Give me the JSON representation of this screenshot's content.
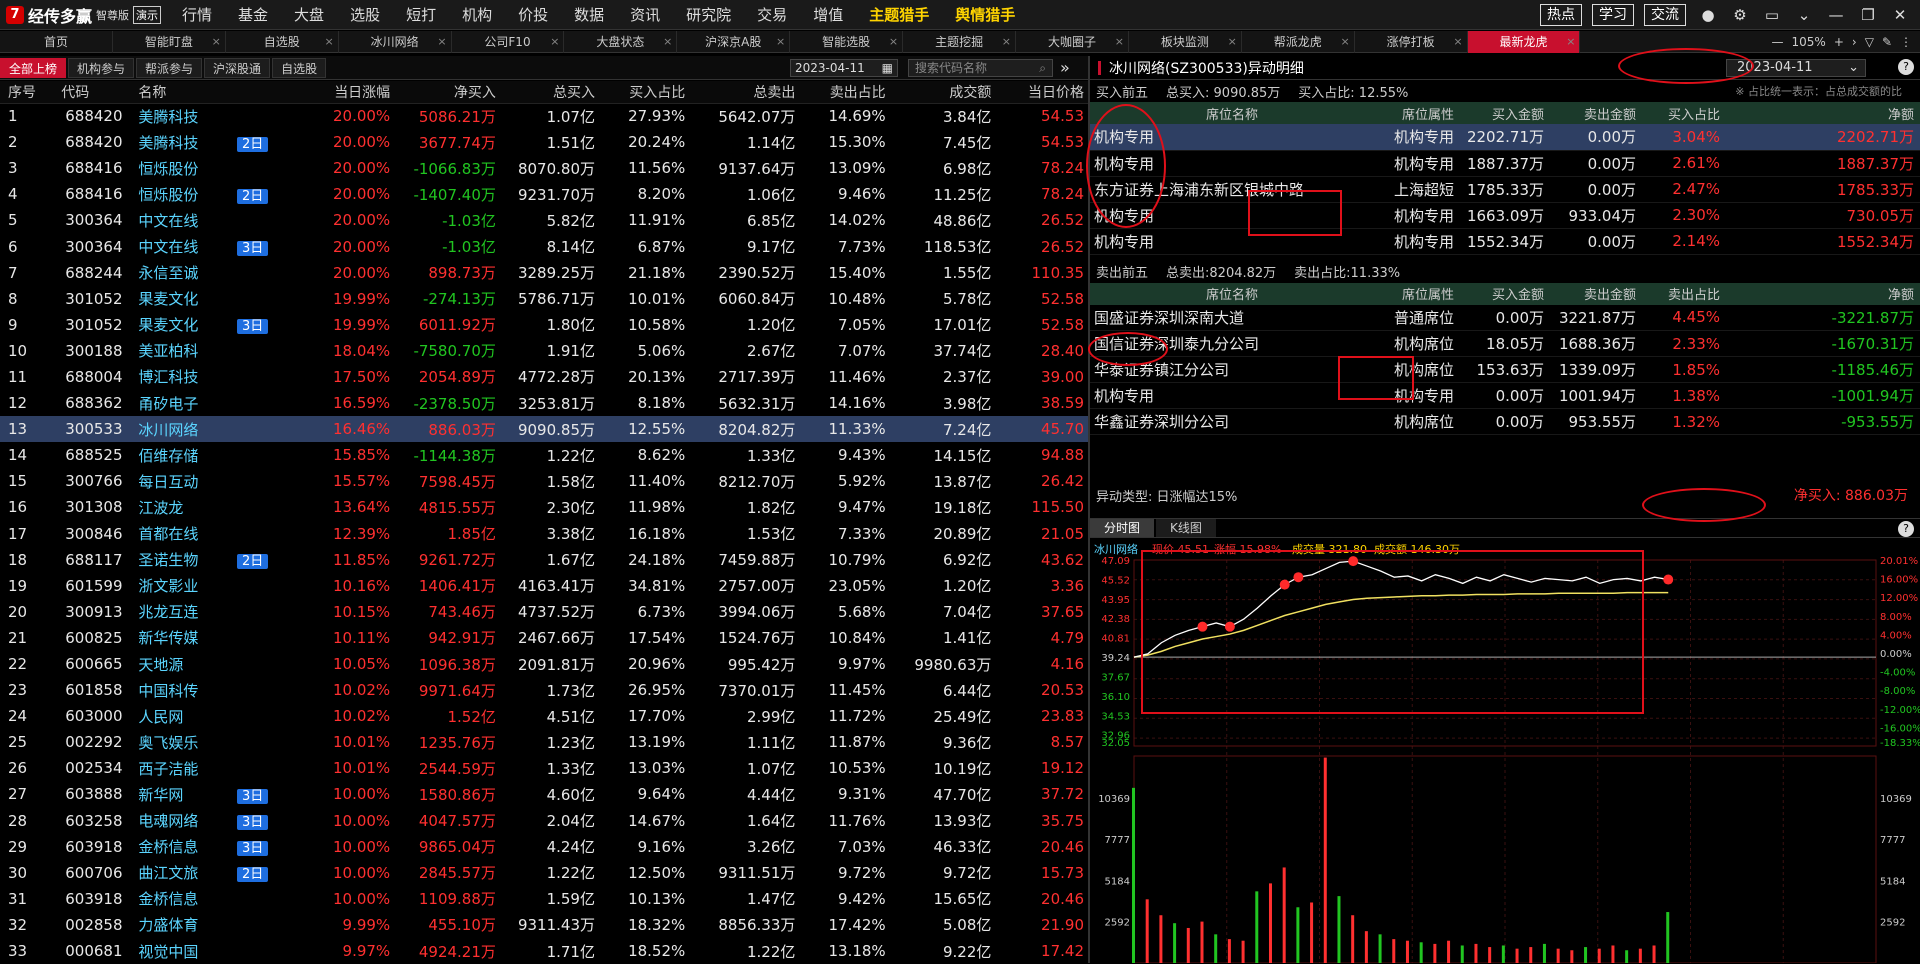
{
  "app": {
    "logo_text": "经传多赢",
    "logo_sub": "智尊版",
    "demo_badge": "演示"
  },
  "top_menu": [
    {
      "label": "行情",
      "hl": false,
      "dot": false
    },
    {
      "label": "基金",
      "hl": false,
      "dot": false
    },
    {
      "label": "大盘",
      "hl": false,
      "dot": false
    },
    {
      "label": "选股",
      "hl": false,
      "dot": false
    },
    {
      "label": "短打",
      "hl": false,
      "dot": false
    },
    {
      "label": "机构",
      "hl": false,
      "dot": false
    },
    {
      "label": "价投",
      "hl": false,
      "dot": false
    },
    {
      "label": "数据",
      "hl": false,
      "dot": false
    },
    {
      "label": "资讯",
      "hl": false,
      "dot": false
    },
    {
      "label": "研究院",
      "hl": false,
      "dot": false
    },
    {
      "label": "交易",
      "hl": false,
      "dot": false
    },
    {
      "label": "增值",
      "hl": false,
      "dot": true
    },
    {
      "label": "主题猎手",
      "hl": true,
      "dot": true
    },
    {
      "label": "舆情猎手",
      "hl": true,
      "dot": true
    }
  ],
  "top_right": {
    "btn_hot": "热点",
    "btn_learn": "学习",
    "btn_talk": "交流",
    "zoom": "105%"
  },
  "tabs": [
    "首页",
    "智能盯盘",
    "自选股",
    "冰川网络",
    "公司F10",
    "大盘状态",
    "沪深京A股",
    "智能选股",
    "主题挖掘",
    "大咖圈子",
    "板块监测",
    "帮派龙虎",
    "涨停打板",
    "最新龙虎"
  ],
  "active_tab": 13,
  "left": {
    "subtabs": [
      "全部上榜",
      "机构参与",
      "帮派参与",
      "沪深股通",
      "自选股"
    ],
    "date": "2023-04-11",
    "search_placeholder": "搜索代码名称",
    "columns": [
      "序号",
      "代码",
      "名称",
      "",
      "当日涨幅",
      "净买入",
      "总买入",
      "买入占比",
      "总卖出",
      "卖出占比",
      "成交额",
      "当日价格"
    ],
    "rows": [
      [
        "1",
        "688420",
        "美腾科技",
        "",
        "20.00%",
        "5086.21万",
        "1.07亿",
        "27.93%",
        "5642.07万",
        "14.69%",
        "3.84亿",
        "54.53"
      ],
      [
        "2",
        "688420",
        "美腾科技",
        "2日",
        "20.00%",
        "3677.74万",
        "1.51亿",
        "20.24%",
        "1.14亿",
        "15.30%",
        "7.45亿",
        "54.53"
      ],
      [
        "3",
        "688416",
        "恒烁股份",
        "",
        "20.00%",
        "-1066.83万",
        "8070.80万",
        "11.56%",
        "9137.64万",
        "13.09%",
        "6.98亿",
        "78.24"
      ],
      [
        "4",
        "688416",
        "恒烁股份",
        "2日",
        "20.00%",
        "-1407.40万",
        "9231.70万",
        "8.20%",
        "1.06亿",
        "9.46%",
        "11.25亿",
        "78.24"
      ],
      [
        "5",
        "300364",
        "中文在线",
        "",
        "20.00%",
        "-1.03亿",
        "5.82亿",
        "11.91%",
        "6.85亿",
        "14.02%",
        "48.86亿",
        "26.52"
      ],
      [
        "6",
        "300364",
        "中文在线",
        "3日",
        "20.00%",
        "-1.03亿",
        "8.14亿",
        "6.87%",
        "9.17亿",
        "7.73%",
        "118.53亿",
        "26.52"
      ],
      [
        "7",
        "688244",
        "永信至诚",
        "",
        "20.00%",
        "898.73万",
        "3289.25万",
        "21.18%",
        "2390.52万",
        "15.40%",
        "1.55亿",
        "110.35"
      ],
      [
        "8",
        "301052",
        "果麦文化",
        "",
        "19.99%",
        "-274.13万",
        "5786.71万",
        "10.01%",
        "6060.84万",
        "10.48%",
        "5.78亿",
        "52.58"
      ],
      [
        "9",
        "301052",
        "果麦文化",
        "3日",
        "19.99%",
        "6011.92万",
        "1.80亿",
        "10.58%",
        "1.20亿",
        "7.05%",
        "17.01亿",
        "52.58"
      ],
      [
        "10",
        "300188",
        "美亚柏科",
        "",
        "18.04%",
        "-7580.70万",
        "1.91亿",
        "5.06%",
        "2.67亿",
        "7.07%",
        "37.74亿",
        "28.40"
      ],
      [
        "11",
        "688004",
        "博汇科技",
        "",
        "17.50%",
        "2054.89万",
        "4772.28万",
        "20.13%",
        "2717.39万",
        "11.46%",
        "2.37亿",
        "39.00"
      ],
      [
        "12",
        "688362",
        "甬矽电子",
        "",
        "16.59%",
        "-2378.50万",
        "3253.81万",
        "8.18%",
        "5632.31万",
        "14.16%",
        "3.98亿",
        "38.59"
      ],
      [
        "13",
        "300533",
        "冰川网络",
        "",
        "16.46%",
        "886.03万",
        "9090.85万",
        "12.55%",
        "8204.82万",
        "11.33%",
        "7.24亿",
        "45.70"
      ],
      [
        "14",
        "688525",
        "佰维存储",
        "",
        "15.85%",
        "-1144.38万",
        "1.22亿",
        "8.62%",
        "1.33亿",
        "9.43%",
        "14.15亿",
        "94.88"
      ],
      [
        "15",
        "300766",
        "每日互动",
        "",
        "15.57%",
        "7598.45万",
        "1.58亿",
        "11.40%",
        "8212.70万",
        "5.92%",
        "13.87亿",
        "26.42"
      ],
      [
        "16",
        "301308",
        "江波龙",
        "",
        "13.64%",
        "4815.55万",
        "2.30亿",
        "11.98%",
        "1.82亿",
        "9.47%",
        "19.18亿",
        "115.50"
      ],
      [
        "17",
        "300846",
        "首都在线",
        "",
        "12.39%",
        "1.85亿",
        "3.38亿",
        "16.18%",
        "1.53亿",
        "7.33%",
        "20.89亿",
        "21.05"
      ],
      [
        "18",
        "688117",
        "圣诺生物",
        "2日",
        "11.85%",
        "9261.72万",
        "1.67亿",
        "24.18%",
        "7459.88万",
        "10.79%",
        "6.92亿",
        "43.62"
      ],
      [
        "19",
        "601599",
        "浙文影业",
        "",
        "10.16%",
        "1406.41万",
        "4163.41万",
        "34.81%",
        "2757.00万",
        "23.05%",
        "1.20亿",
        "3.36"
      ],
      [
        "20",
        "300913",
        "兆龙互连",
        "",
        "10.15%",
        "743.46万",
        "4737.52万",
        "6.73%",
        "3994.06万",
        "5.68%",
        "7.04亿",
        "37.65"
      ],
      [
        "21",
        "600825",
        "新华传媒",
        "",
        "10.11%",
        "942.91万",
        "2467.66万",
        "17.54%",
        "1524.76万",
        "10.84%",
        "1.41亿",
        "4.79"
      ],
      [
        "22",
        "600665",
        "天地源",
        "",
        "10.05%",
        "1096.38万",
        "2091.81万",
        "20.96%",
        "995.42万",
        "9.97%",
        "9980.63万",
        "4.16"
      ],
      [
        "23",
        "601858",
        "中国科传",
        "",
        "10.02%",
        "9971.64万",
        "1.73亿",
        "26.95%",
        "7370.01万",
        "11.45%",
        "6.44亿",
        "20.53"
      ],
      [
        "24",
        "603000",
        "人民网",
        "",
        "10.02%",
        "1.52亿",
        "4.51亿",
        "17.70%",
        "2.99亿",
        "11.72%",
        "25.49亿",
        "23.83"
      ],
      [
        "25",
        "002292",
        "奥飞娱乐",
        "",
        "10.01%",
        "1235.76万",
        "1.23亿",
        "13.19%",
        "1.11亿",
        "11.87%",
        "9.36亿",
        "8.57"
      ],
      [
        "26",
        "002534",
        "西子洁能",
        "",
        "10.01%",
        "2544.59万",
        "1.33亿",
        "13.03%",
        "1.07亿",
        "10.53%",
        "10.19亿",
        "19.12"
      ],
      [
        "27",
        "603888",
        "新华网",
        "3日",
        "10.00%",
        "1580.86万",
        "4.60亿",
        "9.64%",
        "4.44亿",
        "9.31%",
        "47.70亿",
        "37.72"
      ],
      [
        "28",
        "603258",
        "电魂网络",
        "3日",
        "10.00%",
        "4047.57万",
        "2.04亿",
        "14.67%",
        "1.64亿",
        "11.76%",
        "13.93亿",
        "35.75"
      ],
      [
        "29",
        "603918",
        "金桥信息",
        "3日",
        "10.00%",
        "9865.04万",
        "4.24亿",
        "9.16%",
        "3.26亿",
        "7.03%",
        "46.33亿",
        "20.46"
      ],
      [
        "30",
        "600706",
        "曲江文旅",
        "2日",
        "10.00%",
        "2845.57万",
        "1.22亿",
        "12.50%",
        "9311.51万",
        "9.72%",
        "9.72亿",
        "15.73"
      ],
      [
        "31",
        "603918",
        "金桥信息",
        "",
        "10.00%",
        "1109.88万",
        "1.59亿",
        "10.13%",
        "1.47亿",
        "9.42%",
        "15.65亿",
        "20.46"
      ],
      [
        "32",
        "002858",
        "力盛体育",
        "",
        "9.99%",
        "455.10万",
        "9311.43万",
        "18.32%",
        "8856.33万",
        "17.42%",
        "5.08亿",
        "21.90"
      ],
      [
        "33",
        "000681",
        "视觉中国",
        "",
        "9.97%",
        "4924.21万",
        "1.71亿",
        "18.52%",
        "1.22亿",
        "13.18%",
        "9.22亿",
        "17.42"
      ]
    ],
    "selected_row": 12
  },
  "right": {
    "title": "冰川网络(SZ300533)异动明细",
    "date": "2023-04-11",
    "buy_label": "买入前五",
    "buy_total": "总买入: 9090.85万",
    "buy_ratio": "买入占比: 12.55%",
    "note": "※ 占比统一表示：占总成交额的比",
    "seat_columns": [
      "席位名称",
      "席位属性",
      "买入金额",
      "卖出金额",
      "买入占比",
      "净额"
    ],
    "buy_rows": [
      [
        "机构专用",
        "机构专用",
        "2202.71万",
        "0.00万",
        "3.04%",
        "2202.71万"
      ],
      [
        "机构专用",
        "机构专用",
        "1887.37万",
        "0.00万",
        "2.61%",
        "1887.37万"
      ],
      [
        "东方证券上海浦东新区银城中路",
        "上海超短",
        "1785.33万",
        "0.00万",
        "2.47%",
        "1785.33万"
      ],
      [
        "机构专用",
        "机构专用",
        "1663.09万",
        "933.04万",
        "2.30%",
        "730.05万"
      ],
      [
        "机构专用",
        "机构专用",
        "1552.34万",
        "0.00万",
        "2.14%",
        "1552.34万"
      ]
    ],
    "sell_label": "卖出前五",
    "sell_total": "总卖出:8204.82万",
    "sell_ratio": "卖出占比:11.33%",
    "sell_columns": [
      "席位名称",
      "席位属性",
      "买入金额",
      "卖出金额",
      "卖出占比",
      "净额"
    ],
    "sell_rows": [
      [
        "国盛证券深圳深南大道",
        "普通席位",
        "0.00万",
        "3221.87万",
        "4.45%",
        "-3221.87万"
      ],
      [
        "国信证券深圳泰九分公司",
        "机构席位",
        "18.05万",
        "1688.36万",
        "2.33%",
        "-1670.31万"
      ],
      [
        "华泰证券镇江分公司",
        "机构席位",
        "153.63万",
        "1339.09万",
        "1.85%",
        "-1185.46万"
      ],
      [
        "机构专用",
        "机构专用",
        "0.00万",
        "1001.94万",
        "1.38%",
        "-1001.94万"
      ],
      [
        "华鑫证券深圳分公司",
        "机构席位",
        "0.00万",
        "953.55万",
        "1.32%",
        "-953.55万"
      ]
    ],
    "anomaly": "异动类型: 日涨幅达15%",
    "net_buy": "净买入: 886.03万",
    "chart_tabs": [
      "分时图",
      "K线图"
    ]
  },
  "chart_data": {
    "type": "line",
    "info": {
      "name": "冰川网络",
      "price": "现价 45.51",
      "chg": "涨幅 15.98%",
      "vol": "成交量 321.80",
      "amt": "成交额 146.30万"
    },
    "price_ticks": [
      "47.09",
      "45.52",
      "43.95",
      "42.38",
      "40.81",
      "39.24",
      "37.67",
      "36.10",
      "34.53",
      "32.96",
      "32.05"
    ],
    "pct_ticks": [
      "20.01%",
      "16.00%",
      "12.00%",
      "8.00%",
      "4.00%",
      "0.00%",
      "-4.00%",
      "-8.00%",
      "-12.00%",
      "-16.00%",
      "-18.33%"
    ],
    "vol_ticks": [
      "10369",
      "7777",
      "5184",
      "2592"
    ],
    "ylim": [
      32.05,
      47.09
    ],
    "price": [
      39.24,
      39.5,
      40.4,
      41.0,
      41.4,
      41.7,
      42.0,
      41.7,
      42.3,
      43.2,
      44.2,
      45.1,
      45.7,
      45.9,
      46.4,
      46.9,
      47.0,
      46.6,
      46.2,
      45.7,
      45.8,
      45.4,
      45.9,
      45.6,
      45.2,
      45.7,
      45.4,
      45.9,
      45.6,
      45.3,
      45.6,
      45.5,
      45.4,
      45.7,
      45.2,
      45.5,
      45.6,
      45.4,
      45.7,
      45.51
    ],
    "avg": [
      39.24,
      39.4,
      39.7,
      40.1,
      40.4,
      40.7,
      40.9,
      41.1,
      41.4,
      41.8,
      42.2,
      42.6,
      42.9,
      43.2,
      43.5,
      43.7,
      43.9,
      44.0,
      44.05,
      44.1,
      44.15,
      44.2,
      44.2,
      44.25,
      44.25,
      44.3,
      44.3,
      44.3,
      44.35,
      44.35,
      44.35,
      44.4,
      44.4,
      44.4,
      44.4,
      44.4,
      44.45,
      44.45,
      44.45,
      44.45
    ],
    "volume": [
      11000,
      4000,
      3000,
      2500,
      2200,
      2600,
      1800,
      1500,
      1400,
      4500,
      5000,
      6000,
      3500,
      3800,
      12900,
      4200,
      3000,
      2000,
      1800,
      1500,
      1400,
      1300,
      1200,
      1400,
      1100,
      1200,
      1000,
      1100,
      900,
      1000,
      1200,
      900,
      800,
      1000,
      900,
      1100,
      800,
      900,
      1100,
      3200
    ]
  }
}
